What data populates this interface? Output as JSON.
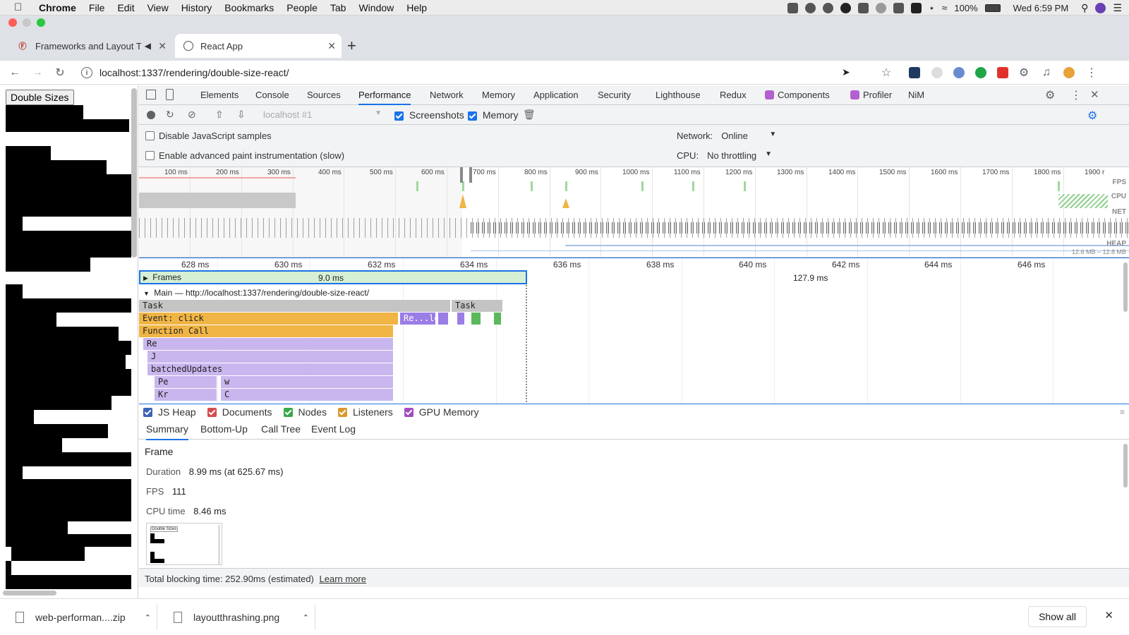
{
  "menubar": {
    "app": "Chrome",
    "items": [
      "File",
      "Edit",
      "View",
      "History",
      "Bookmarks",
      "People",
      "Tab",
      "Window",
      "Help"
    ],
    "battery": "100%",
    "clock": "Wed 6:59 PM"
  },
  "tabs": [
    {
      "title": "Frameworks and Layout Th"
    },
    {
      "title": "React App"
    }
  ],
  "new_tab": "+",
  "url": "localhost:1337/rendering/double-size-react/",
  "page": {
    "button": "Double Sizes"
  },
  "devtools": {
    "tabs": [
      "Elements",
      "Console",
      "Sources",
      "Performance",
      "Network",
      "Memory",
      "Application",
      "Security",
      "Lighthouse",
      "Redux",
      "Components",
      "Profiler",
      "NiM"
    ],
    "active_tab": "Performance",
    "perf_toolbar": {
      "target": "localhost #1",
      "screenshots": "Screenshots",
      "memory": "Memory"
    },
    "settings": {
      "disable_js": "Disable JavaScript samples",
      "advanced_paint": "Enable advanced paint instrumentation (slow)",
      "network_label": "Network:",
      "network_value": "Online",
      "cpu_label": "CPU:",
      "cpu_value": "No throttling"
    },
    "overview": {
      "ticks": [
        "100 ms",
        "200 ms",
        "300 ms",
        "400 ms",
        "500 ms",
        "600 ms",
        "700 ms",
        "800 ms",
        "900 ms",
        "1000 ms",
        "1100 ms",
        "1200 ms",
        "1300 ms",
        "1400 ms",
        "1500 ms",
        "1600 ms",
        "1700 ms",
        "1800 ms",
        "1900 r"
      ],
      "lanes": [
        "FPS",
        "CPU",
        "NET",
        "HEAP"
      ],
      "heap_range": "12.6 MB – 12.8 MB"
    },
    "timeline": {
      "ticks": [
        "628 ms",
        "630 ms",
        "632 ms",
        "634 ms",
        "636 ms",
        "638 ms",
        "640 ms",
        "642 ms",
        "644 ms",
        "646 ms"
      ],
      "frames_label": "Frames",
      "frame_duration": "9.0 ms",
      "frame_duration2": "127.9 ms",
      "main_label": "Main — http://localhost:1337/rendering/double-size-react/",
      "task": "Task",
      "task2": "Task",
      "event": "Event: click",
      "rele": "Re...le",
      "function_call": "Function Call",
      "re": "Re",
      "j": "J",
      "batched": "batchedUpdates",
      "pe": "Pe",
      "w": "w",
      "kr": "Kr",
      "c": "C"
    },
    "counters": [
      "JS Heap",
      "Documents",
      "Nodes",
      "Listeners",
      "GPU Memory"
    ],
    "bottom_tabs": [
      "Summary",
      "Bottom-Up",
      "Call Tree",
      "Event Log"
    ],
    "summary": {
      "title": "Frame",
      "duration_label": "Duration",
      "duration_value": "8.99 ms (at 625.67 ms)",
      "fps_label": "FPS",
      "fps_value": "111",
      "cpu_label": "CPU time",
      "cpu_value": "8.46 ms",
      "thumb_label": "Double Sizes"
    },
    "blocking": "Total blocking time: 252.90ms (estimated)",
    "learn_more": "Learn more"
  },
  "downloads": [
    {
      "name": "web-performan....zip"
    },
    {
      "name": "layoutthrashing.png"
    }
  ],
  "show_all": "Show all"
}
